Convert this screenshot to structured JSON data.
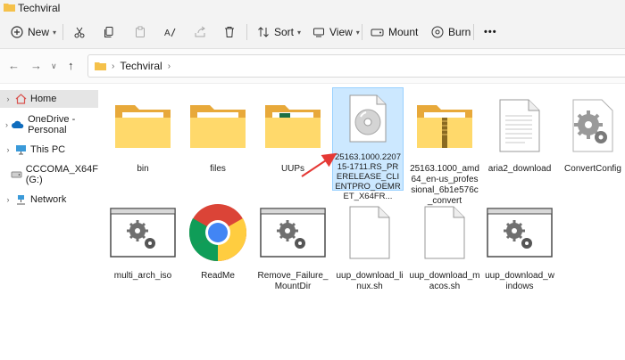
{
  "window": {
    "title": "Techviral"
  },
  "toolbar": {
    "new_label": "New",
    "sort_label": "Sort",
    "view_label": "View",
    "mount_label": "Mount",
    "burn_label": "Burn",
    "more_label": "•••"
  },
  "address": {
    "crumbs": [
      "Techviral"
    ]
  },
  "sidebar": {
    "items": [
      {
        "label": "Home"
      },
      {
        "label": "OneDrive - Personal"
      },
      {
        "label": "This PC"
      },
      {
        "label": "CCCOMA_X64F (G:)"
      },
      {
        "label": "Network"
      }
    ]
  },
  "files": [
    {
      "name": "bin",
      "type": "folder"
    },
    {
      "name": "files",
      "type": "folder"
    },
    {
      "name": "UUPs",
      "type": "folder"
    },
    {
      "name": "25163.1000.220715-1711.RS_PRERELEASE_CLIENTPRO_OEMRET_X64FR...",
      "type": "iso",
      "selected": true
    },
    {
      "name": "25163.1000_amd64_en-us_professional_6b1e576c_convert",
      "type": "zip-folder"
    },
    {
      "name": "aria2_download",
      "type": "text"
    },
    {
      "name": "ConvertConfig",
      "type": "config"
    },
    {
      "name": "multi_arch_iso",
      "type": "script-window"
    },
    {
      "name": "ReadMe",
      "type": "chrome"
    },
    {
      "name": "Remove_Failure_MountDir",
      "type": "script-window"
    },
    {
      "name": "uup_download_linux.sh",
      "type": "blank"
    },
    {
      "name": "uup_download_macos.sh",
      "type": "blank"
    },
    {
      "name": "uup_download_windows",
      "type": "script-window"
    }
  ],
  "colors": {
    "folder": "#f5c14a",
    "folder_front": "#ffd96b",
    "selection": "#cce8ff",
    "arrow": "#e53935"
  }
}
